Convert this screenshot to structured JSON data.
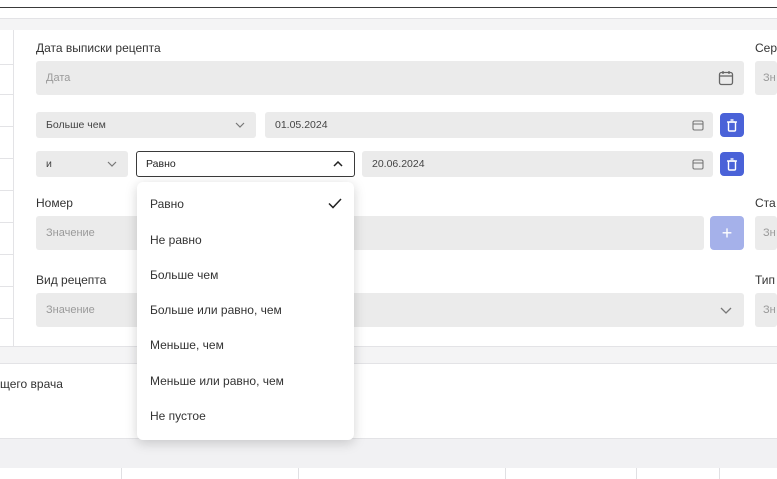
{
  "form": {
    "issue_date_label": "Дата выписки рецепта",
    "issue_date_placeholder": "Дата",
    "series_label_partial": "Сер",
    "series_value_partial": "Зн",
    "row1": {
      "operator": "Больше чем",
      "date": "01.05.2024"
    },
    "row2": {
      "logic": "и",
      "operator": "Равно",
      "date": "20.06.2024"
    },
    "number_label": "Номер",
    "number_placeholder": "Значение",
    "status_label_partial": "Ста",
    "status_value_partial": "Зн",
    "type_label": "Вид рецепта",
    "type_placeholder": "Значение",
    "tip_label_partial": "Тип",
    "tip_value_partial": "Зн",
    "add_label": "+"
  },
  "dropdown": {
    "options": [
      {
        "label": "Равно",
        "selected": true
      },
      {
        "label": "Не равно",
        "selected": false
      },
      {
        "label": "Больше чем",
        "selected": false
      },
      {
        "label": "Больше или равно, чем",
        "selected": false
      },
      {
        "label": "Меньше, чем",
        "selected": false
      },
      {
        "label": "Меньше или равно, чем",
        "selected": false
      },
      {
        "label": "Не пустое",
        "selected": false
      }
    ]
  },
  "lower": {
    "doctor_label_partial": "щего врача"
  },
  "colors": {
    "accent": "#4a62d8",
    "accent_light": "#a5b1ea",
    "field_bg": "#ebebeb"
  }
}
